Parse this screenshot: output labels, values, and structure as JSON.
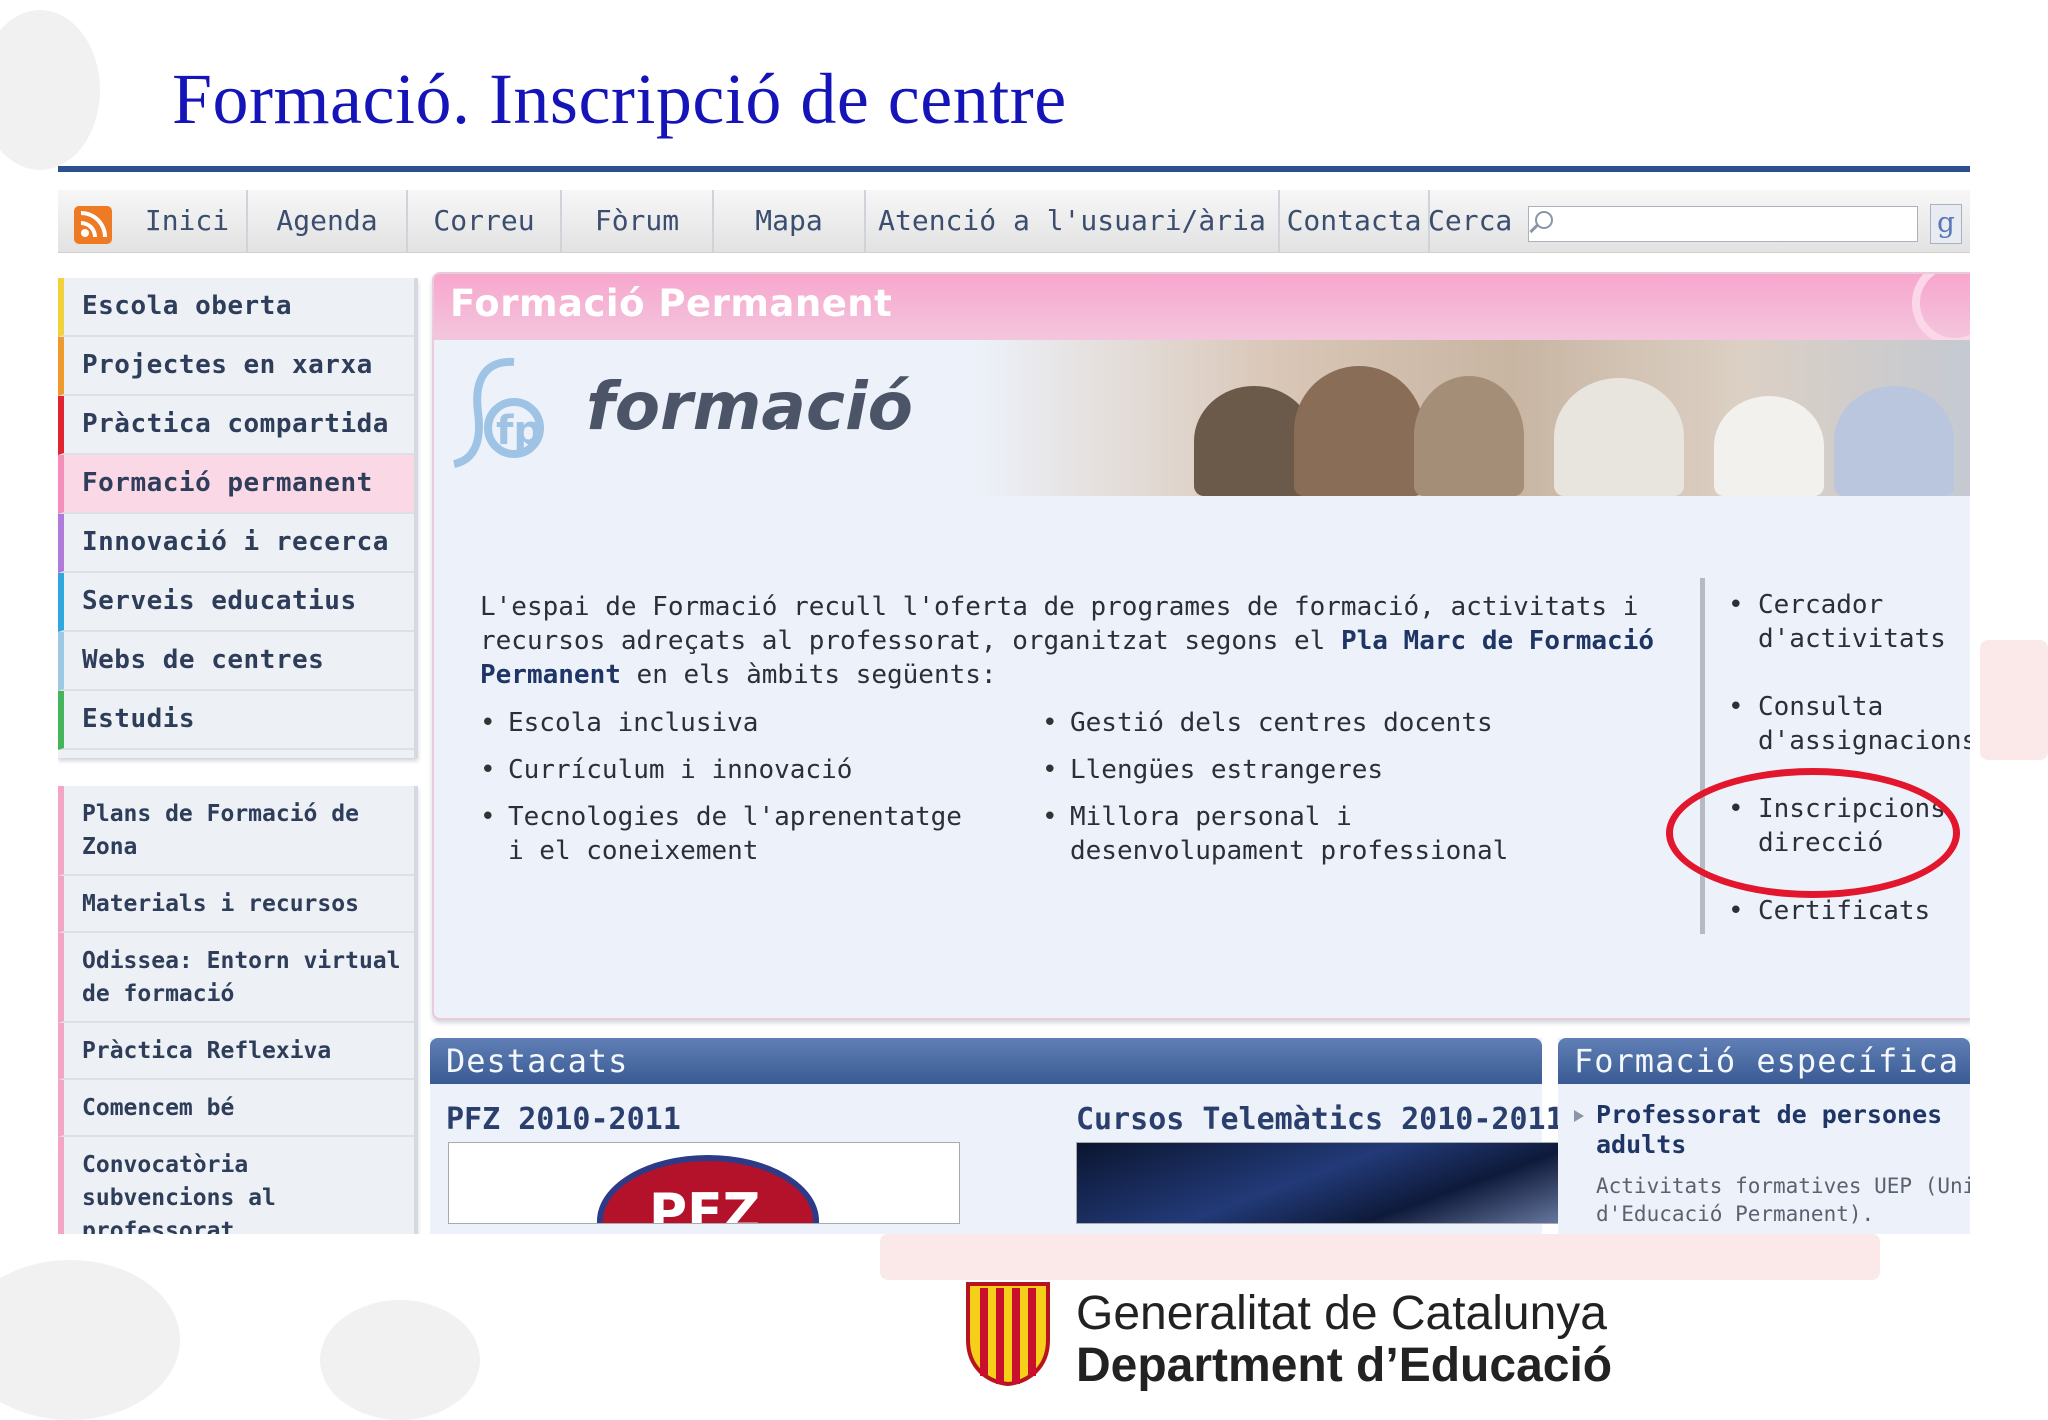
{
  "slide": {
    "title": "Formació. Inscripció de centre"
  },
  "topnav": {
    "items": [
      "Inici",
      "Agenda",
      "Correu",
      "Fòrum",
      "Mapa",
      "Atenció a l'usuari/ària",
      "Contacta"
    ],
    "search_label": "Cerca",
    "search_placeholder": "",
    "search_button": "g"
  },
  "sidebar": {
    "primary": [
      {
        "label": "Escola oberta",
        "color": "#f2d23c"
      },
      {
        "label": "Projectes en xarxa",
        "color": "#f0992c"
      },
      {
        "label": "Pràctica compartida",
        "color": "#e0232d"
      },
      {
        "label": "Formació permanent",
        "color": "#f48fba"
      },
      {
        "label": "Innovació i recerca",
        "color": "#b07ad9"
      },
      {
        "label": "Serveis educatius",
        "color": "#2fa7e0"
      },
      {
        "label": "Webs de centres",
        "color": "#9fc8e6"
      },
      {
        "label": "Estudis",
        "color": "#46b45a"
      }
    ],
    "secondary": [
      "Plans de Formació de Zona",
      "Materials i recursos",
      "Odissea: Entorn virtual de formació",
      "Pràctica Reflexiva",
      "Comencem bé",
      "Convocatòria subvencions al professorat"
    ]
  },
  "main": {
    "header": "Formació Permanent",
    "logo_text": "formació",
    "logo_mark": "fp",
    "intro_before": "L'espai de Formació recull l'oferta de programes de formació, activitats i recursos adreçats al professorat, organitzat segons el ",
    "intro_link": "Pla Marc de Formació Permanent",
    "intro_after": " en els àmbits següents:",
    "areas_left": [
      "Escola inclusiva",
      "Currículum i innovació",
      "Tecnologies de l'aprenentatge i el coneixement"
    ],
    "areas_right": [
      "Gestió dels centres docents",
      "Llengües estrangeres",
      "Millora personal i desenvolupament professional"
    ],
    "links": [
      "Cercador d'activitats",
      "Consulta d'assignacions",
      "Inscripcions direcció",
      "Certificats"
    ]
  },
  "destacats": {
    "header": "Destacats",
    "item1": "PFZ 2010-2011",
    "item2": "Cursos Telemàtics 2010-2011",
    "thumb1_text": "PFZ"
  },
  "formacio_especifica": {
    "header": "Formació específica",
    "link": "Professorat de persones adults",
    "desc_line1": "Activitats formatives UEP (Uni",
    "desc_line2": "d'Educació Permanent)."
  },
  "footer": {
    "org_line1": "Generalitat de Catalunya",
    "org_line2": "Department d’Educació"
  },
  "colors": {
    "title": "#1414b8",
    "highlight_ring": "#e2162c",
    "pink_header": "#f7a6cd",
    "blue_header": "#3a5a94"
  }
}
